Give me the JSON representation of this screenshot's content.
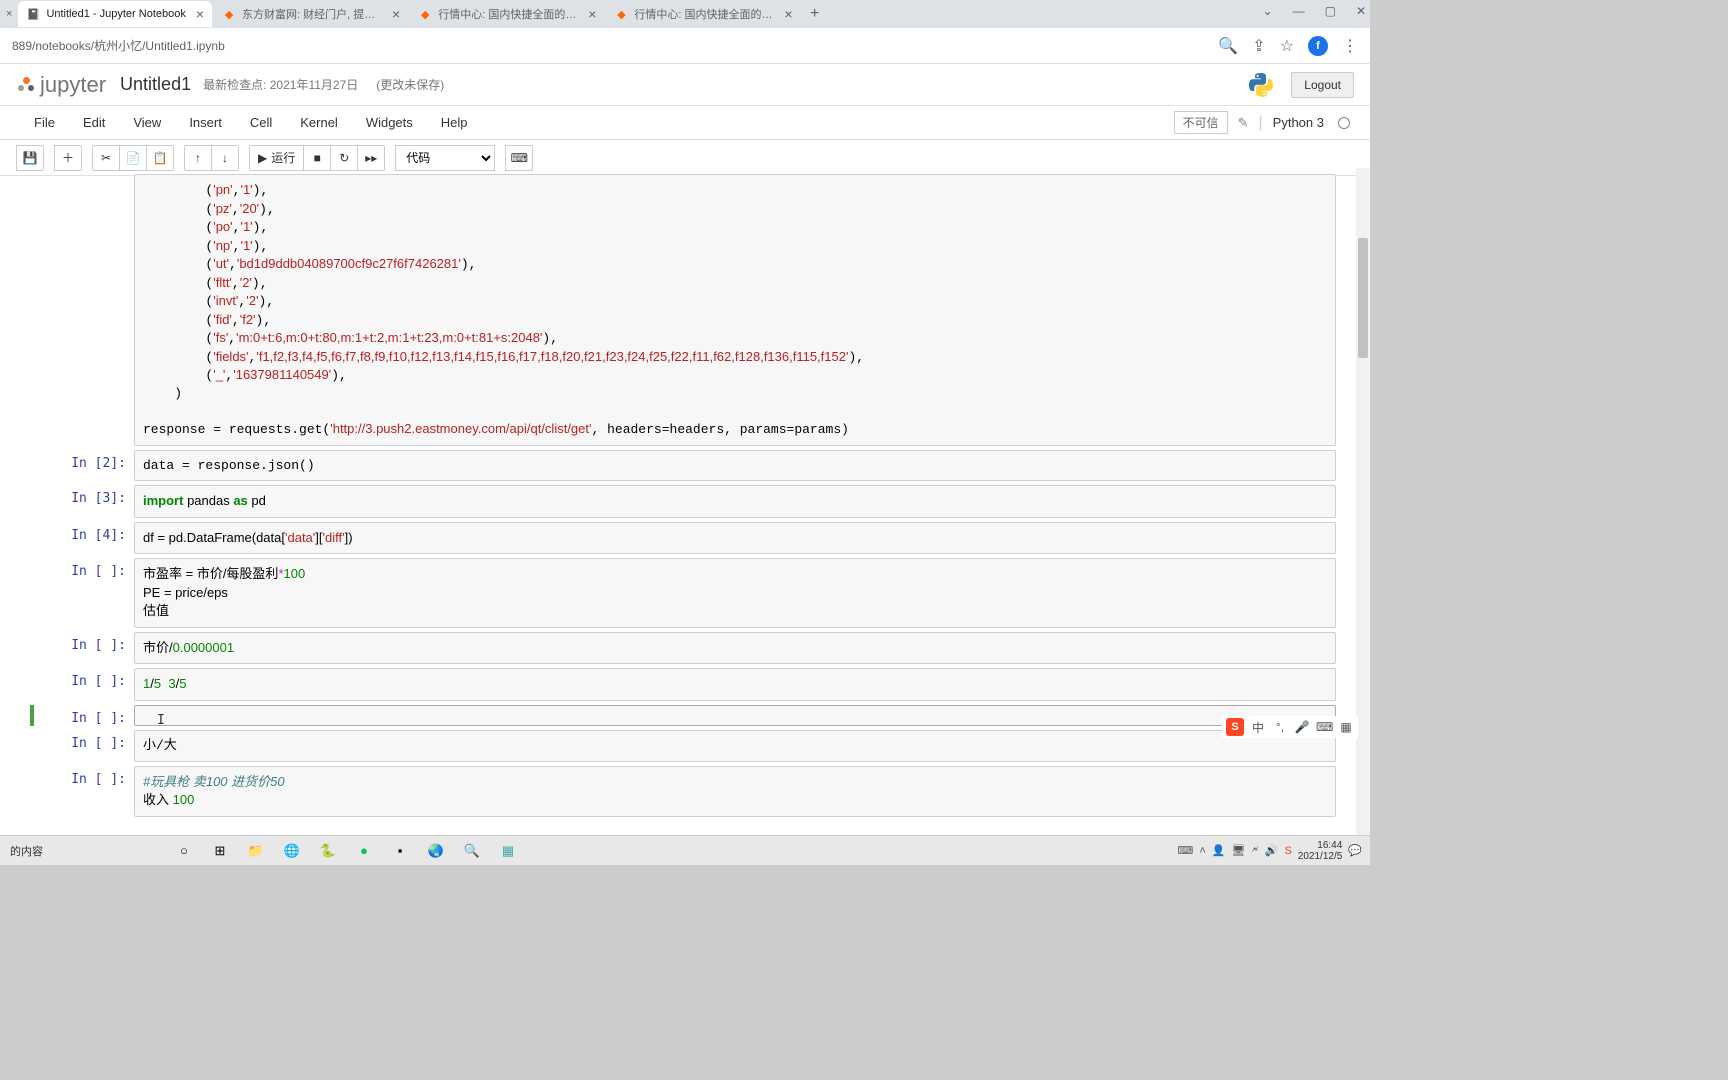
{
  "browser": {
    "tabs": [
      {
        "label": "Untitled1 - Jupyter Notebook",
        "active": true,
        "icon": "jupyter"
      },
      {
        "label": "东方财富网: 财经门户, 提供专...",
        "active": false,
        "icon": "east"
      },
      {
        "label": "行情中心: 国内快捷全面的股票...",
        "active": false,
        "icon": "east"
      },
      {
        "label": "行情中心: 国内快捷全面的股票...",
        "active": false,
        "icon": "east"
      }
    ],
    "url": "889/notebooks/杭州小忆/Untitled1.ipynb",
    "avatar": "f"
  },
  "jupyter": {
    "brand": "jupyter",
    "title": "Untitled1",
    "checkpoint": "最新检查点: 2021年11月27日",
    "unsaved": "(更改未保存)",
    "logout": "Logout",
    "menus": [
      "File",
      "Edit",
      "View",
      "Insert",
      "Cell",
      "Kernel",
      "Widgets",
      "Help"
    ],
    "trust": "不可信",
    "kernel": "Python 3",
    "run_label": "运行",
    "celltype": "代码"
  },
  "cells": [
    {
      "prompt": "",
      "lines": [
        {
          "plain_prefix": "        (",
          "str": "'pn'",
          "mid": ",",
          "str2": "'1'",
          "suffix": "),"
        },
        {
          "plain_prefix": "        (",
          "str": "'pz'",
          "mid": ",",
          "str2": "'20'",
          "suffix": "),"
        },
        {
          "plain_prefix": "        (",
          "str": "'po'",
          "mid": ",",
          "str2": "'1'",
          "suffix": "),"
        },
        {
          "plain_prefix": "        (",
          "str": "'np'",
          "mid": ",",
          "str2": "'1'",
          "suffix": "),"
        },
        {
          "plain_prefix": "        (",
          "str": "'ut'",
          "mid": ",",
          "str2": "'bd1d9ddb04089700cf9c27f6f7426281'",
          "suffix": "),"
        },
        {
          "plain_prefix": "        (",
          "str": "'fltt'",
          "mid": ",",
          "str2": "'2'",
          "suffix": "),"
        },
        {
          "plain_prefix": "        (",
          "str": "'invt'",
          "mid": ",",
          "str2": "'2'",
          "suffix": "),"
        },
        {
          "plain_prefix": "        (",
          "str": "'fid'",
          "mid": ",",
          "str2": "'f2'",
          "suffix": "),"
        },
        {
          "plain_prefix": "        (",
          "str": "'fs'",
          "mid": ",",
          "str2": "'m:0+t:6,m:0+t:80,m:1+t:2,m:1+t:23,m:0+t:81+s:2048'",
          "suffix": "),"
        },
        {
          "plain_prefix": "        (",
          "str": "'fields'",
          "mid": ",",
          "str2": "'f1,f2,f3,f4,f5,f6,f7,f8,f9,f10,f12,f13,f14,f15,f16,f17,f18,f20,f21,f23,f24,f25,f22,f11,f62,f128,f136,f115,f152'",
          "suffix": "),"
        },
        {
          "plain_prefix": "        (",
          "str": "'_'",
          "mid": ",",
          "str2": "'1637981140549'",
          "suffix": "),"
        },
        {
          "plain": "    )"
        },
        {
          "plain": ""
        },
        {
          "resp_line": true,
          "pre": "response = requests.get(",
          "url": "'http://3.push2.eastmoney.com/api/qt/clist/get'",
          "post": ", headers=headers, params=params)"
        }
      ]
    },
    {
      "prompt": "In  [2]:",
      "raw": "data = response.json()"
    },
    {
      "prompt": "In  [3]:",
      "import_line": true,
      "kw1": "import",
      "mod": " pandas ",
      "kw2": "as",
      "alias": " pd"
    },
    {
      "prompt": "In  [4]:",
      "df_line": true,
      "pre": "df = pd.DataFrame(data[",
      "s1": "'data'",
      "mid": "][",
      "s2": "'diff'",
      "post": "])"
    },
    {
      "prompt": "In  [  ]:",
      "pe_block": true,
      "l1_pre": "市盈率 = 市价/每股盈利",
      "l1_op": "*",
      "l1_num": "100",
      "l2": "PE = price/eps",
      "l3": "估值"
    },
    {
      "prompt": "In  [  ]:",
      "div_line": true,
      "pre": "市价/",
      "num": "0.0000001"
    },
    {
      "prompt": "In  [  ]:",
      "frac_line": true,
      "n1": "1",
      "d1": "/",
      "n2": "5",
      "sp": "  ",
      "n3": "3",
      "d2": "/",
      "n4": "5"
    },
    {
      "prompt": "In  [  ]:",
      "selected": true,
      "empty": true,
      "cursor": "I"
    },
    {
      "prompt": "In  [  ]:",
      "raw": "小/大"
    },
    {
      "prompt": "In  [  ]:",
      "toy_block": true,
      "cm": "#玩具枪 卖100 进货价50",
      "l2_pre": "收入 ",
      "l2_num": "100"
    }
  ],
  "ime": {
    "lang": "中"
  },
  "taskbar": {
    "fragment": "的内容",
    "time": "16:44",
    "date": "2021/12/5"
  }
}
